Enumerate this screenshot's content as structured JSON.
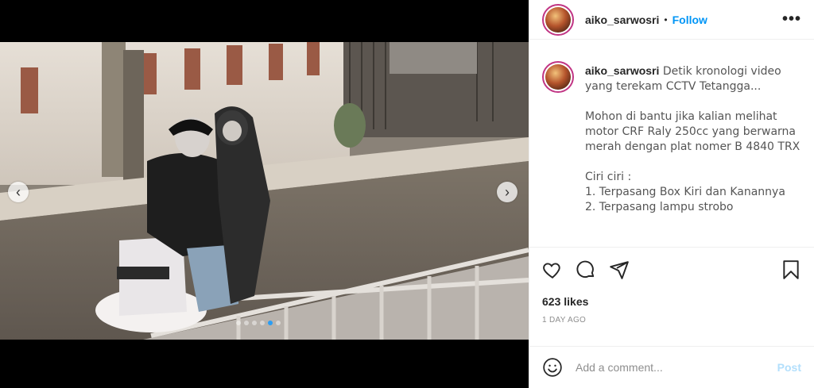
{
  "post": {
    "username": "aiko_sarwosri",
    "separator": "•",
    "follow_label": "Follow",
    "more_label": "•••",
    "caption": {
      "lines": [
        "Detik kronologi video",
        "yang terekam CCTV Tetangga...",
        "",
        "Mohon di bantu jika kalian melihat",
        "motor CRF Raly 250cc yang berwarna",
        "merah dengan plat nomer B 4840 TRX",
        "",
        "Ciri ciri :",
        "1. Terpasang Box Kiri dan Kanannya",
        "2. Terpasang lampu strobo"
      ]
    },
    "likes": "623 likes",
    "date": "1 DAY AGO",
    "comment_placeholder": "Add a comment...",
    "post_label": "Post",
    "carousel": {
      "prev_label": "‹",
      "next_label": "›",
      "total_slides": 6,
      "active_slide": 5
    }
  },
  "colors": {
    "accent": "#0095f6",
    "post_disabled": "#b2dffc",
    "active_dot": "#2a9df4"
  }
}
